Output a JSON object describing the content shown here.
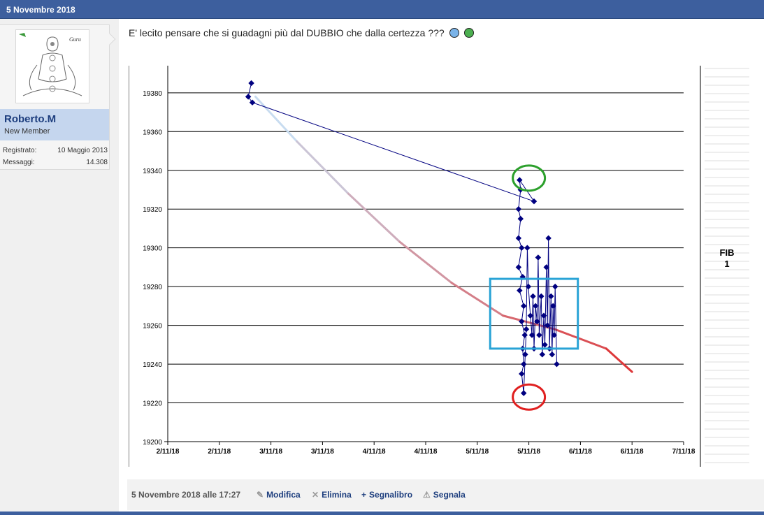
{
  "header": {
    "date": "5 Novembre 2018"
  },
  "user": {
    "name": "Roberto.M",
    "title": "New Member",
    "registered_label": "Registrato:",
    "registered_value": "10 Maggio 2013",
    "messages_label": "Messaggi:",
    "messages_value": "14.308",
    "avatar_text": "Guru"
  },
  "post": {
    "text": "E' lecito pensare che si guadagni più dal DUBBIO che dalla certezza ???",
    "smileys": [
      "laugh-smiley-icon",
      "wink-smiley-icon"
    ]
  },
  "chart_data": {
    "type": "line",
    "y_ticks": [
      19200,
      19220,
      19240,
      19260,
      19280,
      19300,
      19320,
      19340,
      19360,
      19380
    ],
    "x_ticks": [
      "2/11/18",
      "2/11/18",
      "3/11/18",
      "3/11/18",
      "4/11/18",
      "4/11/18",
      "5/11/18",
      "5/11/18",
      "6/11/18",
      "6/11/18",
      "7/11/18"
    ],
    "ylim": [
      19200,
      19394
    ],
    "grid": true,
    "side_label": [
      "FIB",
      "1"
    ],
    "annotations": [
      {
        "shape": "circle",
        "color": "#2ca02c",
        "x": 7.0,
        "y": 19336
      },
      {
        "shape": "circle",
        "color": "#e02020",
        "x": 7.0,
        "y": 19223
      },
      {
        "shape": "rect",
        "color": "#29a3d6",
        "x0": 6.25,
        "x1": 7.95,
        "y0": 19248,
        "y1": 19284
      }
    ],
    "series": [
      {
        "color": "#000080",
        "points": [
          [
            1.62,
            19385
          ],
          [
            1.56,
            19378
          ],
          [
            1.64,
            19375
          ],
          [
            7.1,
            19324
          ],
          [
            6.82,
            19335
          ],
          [
            6.84,
            19330
          ],
          [
            6.8,
            19320
          ],
          [
            6.84,
            19315
          ],
          [
            6.8,
            19305
          ],
          [
            6.86,
            19300
          ],
          [
            6.8,
            19290
          ],
          [
            6.88,
            19285
          ],
          [
            6.82,
            19278
          ],
          [
            6.9,
            19270
          ],
          [
            6.86,
            19262
          ],
          [
            6.92,
            19255
          ],
          [
            6.88,
            19248
          ],
          [
            6.9,
            19240
          ],
          [
            6.86,
            19235
          ],
          [
            6.9,
            19225
          ],
          [
            6.93,
            19245
          ],
          [
            6.95,
            19258
          ],
          [
            6.97,
            19300
          ],
          [
            6.99,
            19280
          ],
          [
            7.03,
            19265
          ],
          [
            7.06,
            19255
          ],
          [
            7.08,
            19275
          ],
          [
            7.1,
            19248
          ],
          [
            7.13,
            19270
          ],
          [
            7.16,
            19262
          ],
          [
            7.18,
            19295
          ],
          [
            7.2,
            19255
          ],
          [
            7.24,
            19275
          ],
          [
            7.26,
            19245
          ],
          [
            7.29,
            19265
          ],
          [
            7.31,
            19250
          ],
          [
            7.34,
            19290
          ],
          [
            7.36,
            19260
          ],
          [
            7.38,
            19305
          ],
          [
            7.4,
            19248
          ],
          [
            7.43,
            19275
          ],
          [
            7.45,
            19245
          ],
          [
            7.47,
            19270
          ],
          [
            7.49,
            19255
          ],
          [
            7.51,
            19280
          ],
          [
            7.54,
            19240
          ]
        ]
      },
      {
        "color": "#e02020",
        "points": [
          [
            1.7,
            19378
          ],
          [
            2.5,
            19355
          ],
          [
            3.5,
            19328
          ],
          [
            4.5,
            19303
          ],
          [
            5.5,
            19282
          ],
          [
            6.5,
            19265
          ],
          [
            7.5,
            19258
          ],
          [
            8.5,
            19248
          ],
          [
            9.0,
            19236
          ]
        ]
      }
    ]
  },
  "footer": {
    "date": "5 Novembre 2018 alle 17:27",
    "edit": "Modifica",
    "delete": "Elimina",
    "bookmark": "Segnalibro",
    "report": "Segnala"
  }
}
